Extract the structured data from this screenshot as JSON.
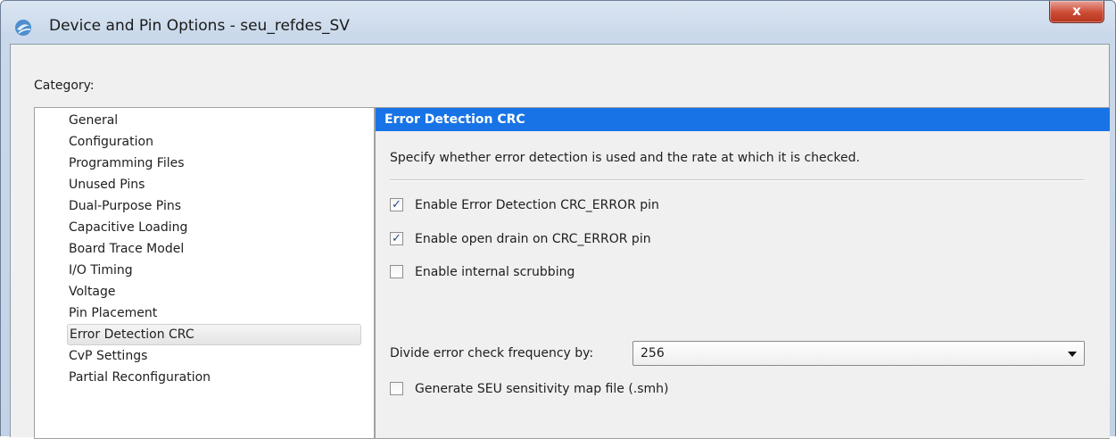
{
  "window": {
    "title": "Device and Pin Options - seu_refdes_SV",
    "close_glyph": "x",
    "app_icon": "quartus-app-icon"
  },
  "category": {
    "label": "Category:",
    "items": [
      {
        "label": "General"
      },
      {
        "label": "Configuration"
      },
      {
        "label": "Programming Files"
      },
      {
        "label": "Unused Pins"
      },
      {
        "label": "Dual-Purpose Pins"
      },
      {
        "label": "Capacitive Loading"
      },
      {
        "label": "Board Trace Model"
      },
      {
        "label": "I/O Timing"
      },
      {
        "label": "Voltage"
      },
      {
        "label": "Pin Placement"
      },
      {
        "label": "Error Detection CRC"
      },
      {
        "label": "CvP Settings"
      },
      {
        "label": "Partial Reconfiguration"
      }
    ],
    "selected": "Error Detection CRC"
  },
  "panel": {
    "header": "Error Detection CRC",
    "description": "Specify whether error detection is used and the rate at which it is checked.",
    "options": [
      {
        "label": "Enable Error Detection CRC_ERROR pin",
        "checked": true
      },
      {
        "label": "Enable open drain on CRC_ERROR pin",
        "checked": true
      },
      {
        "label": "Enable internal scrubbing",
        "checked": false
      }
    ],
    "frequency": {
      "label": "Divide error check frequency by:",
      "value": "256"
    },
    "seu_map": {
      "label": "Generate SEU sensitivity map file (.smh)",
      "checked": false
    }
  },
  "colors": {
    "header_bg": "#1874e6",
    "close_button": "#cc4a33"
  }
}
